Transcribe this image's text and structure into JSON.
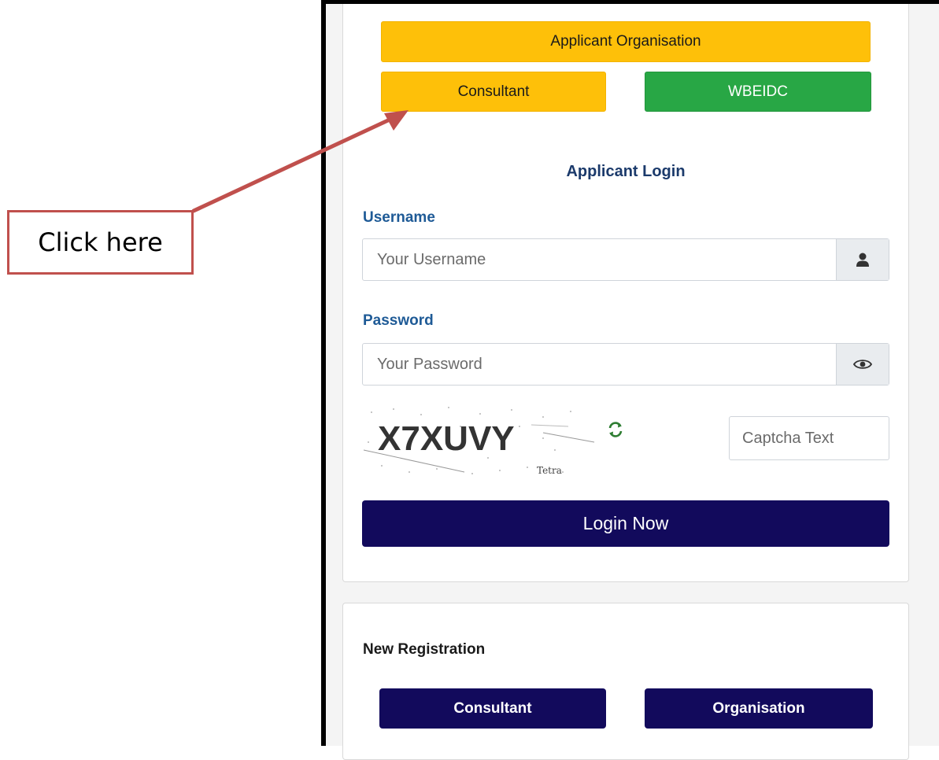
{
  "roles": {
    "applicant_organisation": "Applicant Organisation",
    "consultant": "Consultant",
    "wbeidc": "WBEIDC"
  },
  "login": {
    "title": "Applicant Login",
    "username_label": "Username",
    "username_placeholder": "Your Username",
    "password_label": "Password",
    "password_placeholder": "Your Password",
    "captcha_image_text": "X7XUVY",
    "captcha_brand": "Tetra",
    "captcha_placeholder": "Captcha Text",
    "submit_label": "Login Now"
  },
  "registration": {
    "title": "New Registration",
    "consultant_label": "Consultant",
    "organisation_label": "Organisation"
  },
  "annotation": {
    "callout_text": "Click here"
  },
  "colors": {
    "yellow": "#fec009",
    "green": "#28a745",
    "navy": "#120a5c",
    "label_blue": "#1e5a96",
    "callout_red": "#c0504d"
  },
  "icons": {
    "username_addon": "user-icon",
    "password_addon": "eye-icon",
    "captcha_refresh": "refresh-icon"
  }
}
